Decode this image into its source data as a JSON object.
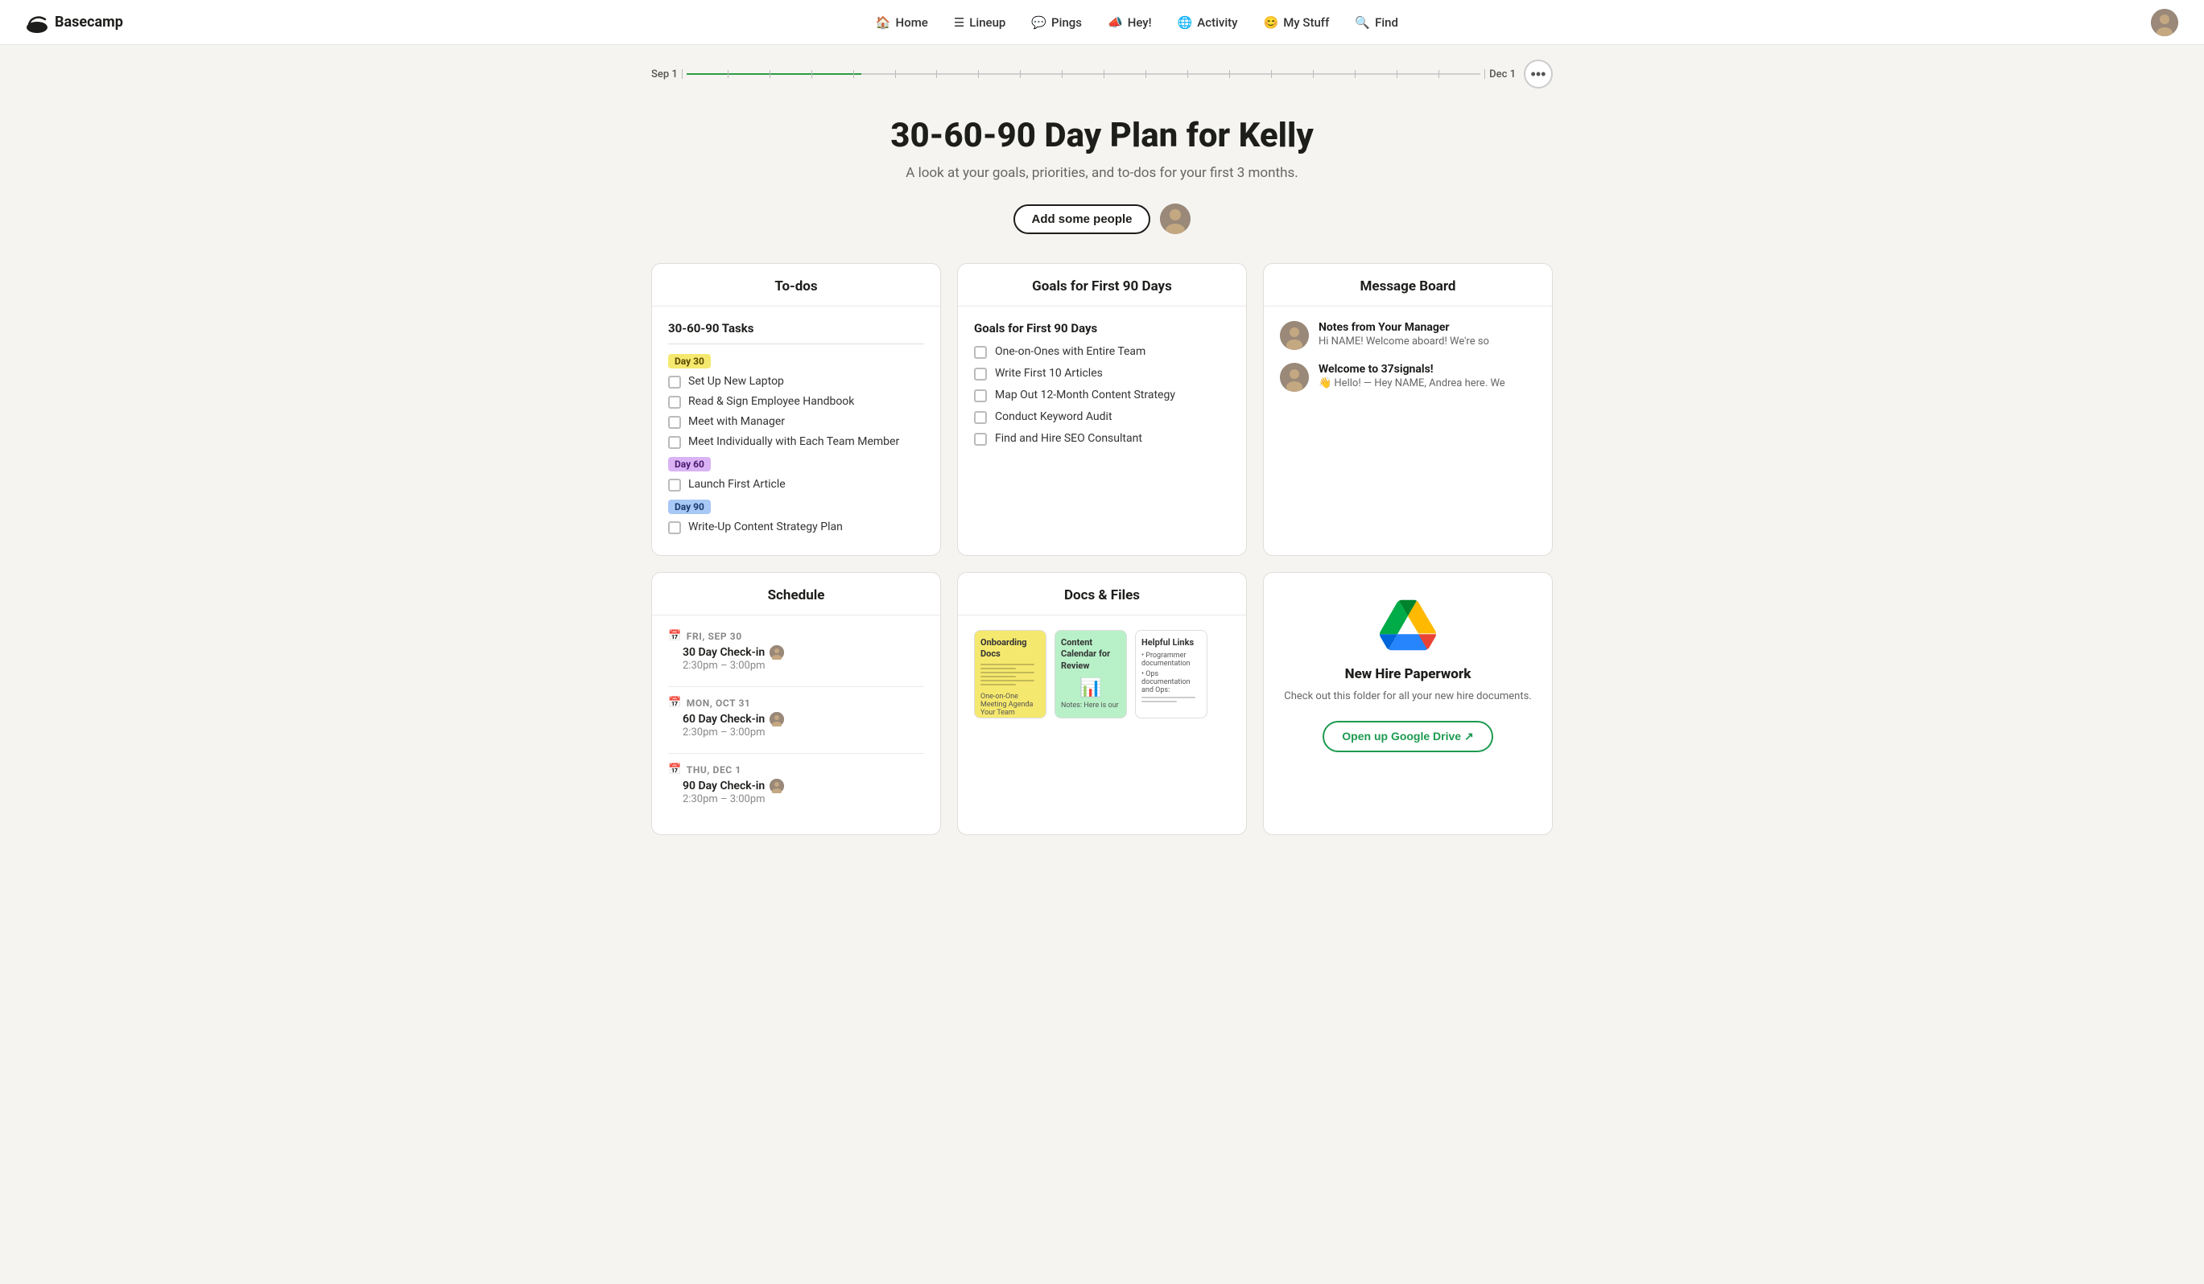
{
  "nav": {
    "logo": "Basecamp",
    "links": [
      {
        "id": "home",
        "label": "Home",
        "icon": "🏠"
      },
      {
        "id": "lineup",
        "label": "Lineup",
        "icon": "≡"
      },
      {
        "id": "pings",
        "label": "Pings",
        "icon": "💬"
      },
      {
        "id": "hey",
        "label": "Hey!",
        "icon": "📣"
      },
      {
        "id": "activity",
        "label": "Activity",
        "icon": "🌐"
      },
      {
        "id": "mystuff",
        "label": "My Stuff",
        "icon": "😊"
      },
      {
        "id": "find",
        "label": "Find",
        "icon": "🔍"
      }
    ]
  },
  "timeline": {
    "start_label": "Sep 1",
    "end_label": "Dec 1",
    "progress_pct": 22
  },
  "hero": {
    "title": "30-60-90 Day Plan for Kelly",
    "subtitle": "A look at your goals, priorities, and to-dos for your first 3 months.",
    "add_people_label": "Add some people",
    "more_options_label": "..."
  },
  "todos": {
    "card_title": "To-dos",
    "section_title": "30-60-90 Tasks",
    "day30_label": "Day 30",
    "day60_label": "Day 60",
    "day90_label": "Day 90",
    "day30_items": [
      "Set Up New Laptop",
      "Read & Sign Employee Handbook",
      "Meet with Manager",
      "Meet Individually with Each Team Member"
    ],
    "day60_items": [
      "Launch First Article"
    ],
    "day90_items": [
      "Write-Up Content Strategy Plan"
    ]
  },
  "goals": {
    "card_title": "Goals for First 90 Days",
    "section_title": "Goals for First 90 Days",
    "items": [
      "One-on-Ones with Entire Team",
      "Write First 10 Articles",
      "Map Out 12-Month Content Strategy",
      "Conduct Keyword Audit",
      "Find and Hire SEO Consultant"
    ]
  },
  "messages": {
    "card_title": "Message Board",
    "items": [
      {
        "id": "msg1",
        "title": "Notes from Your Manager",
        "preview": "Hi NAME! Welcome aboard! We're so"
      },
      {
        "id": "msg2",
        "title": "Welcome to 37signals!",
        "preview": "👋 Hello! — Hey NAME, Andrea here. We"
      }
    ]
  },
  "schedule": {
    "card_title": "Schedule",
    "events": [
      {
        "id": "evt1",
        "date_label": "FRI, SEP 30",
        "cal_color": "red",
        "event_name": "30 Day Check-in",
        "time": "2:30pm – 3:00pm"
      },
      {
        "id": "evt2",
        "date_label": "MON, OCT 31",
        "cal_color": "red",
        "event_name": "60 Day Check-in",
        "time": "2:30pm – 3:00pm"
      },
      {
        "id": "evt3",
        "date_label": "THU, DEC 1",
        "cal_color": "blue",
        "event_name": "90 Day Check-in",
        "time": "2:30pm – 3:00pm"
      }
    ]
  },
  "docs": {
    "card_title": "Docs & Files",
    "items": [
      {
        "id": "doc1",
        "thumb_class": "doc-thumb-yellow",
        "title": "Onboarding Docs",
        "lines": [
          "One-on-One Meeting Agenda",
          "Your Team"
        ]
      },
      {
        "id": "doc2",
        "thumb_class": "doc-thumb-green",
        "title": "Content Calendar for Review",
        "icon": "📊",
        "subtitle": "Notes: Here is our"
      },
      {
        "id": "doc3",
        "thumb_class": "doc-thumb-white",
        "title": "Helpful Links",
        "lines": [
          "Programmer documentation",
          "Ops documentation and Ops:"
        ]
      }
    ]
  },
  "google_drive": {
    "card_title": "",
    "drive_title": "New Hire Paperwork",
    "drive_desc": "Check out this folder for all your new hire documents.",
    "btn_label": "Open up Google Drive ↗"
  },
  "colors": {
    "accent_green": "#2d9c45",
    "day30_bg": "#f5e86e",
    "day60_bg": "#d9b3f5",
    "day90_bg": "#a8c8f5"
  }
}
